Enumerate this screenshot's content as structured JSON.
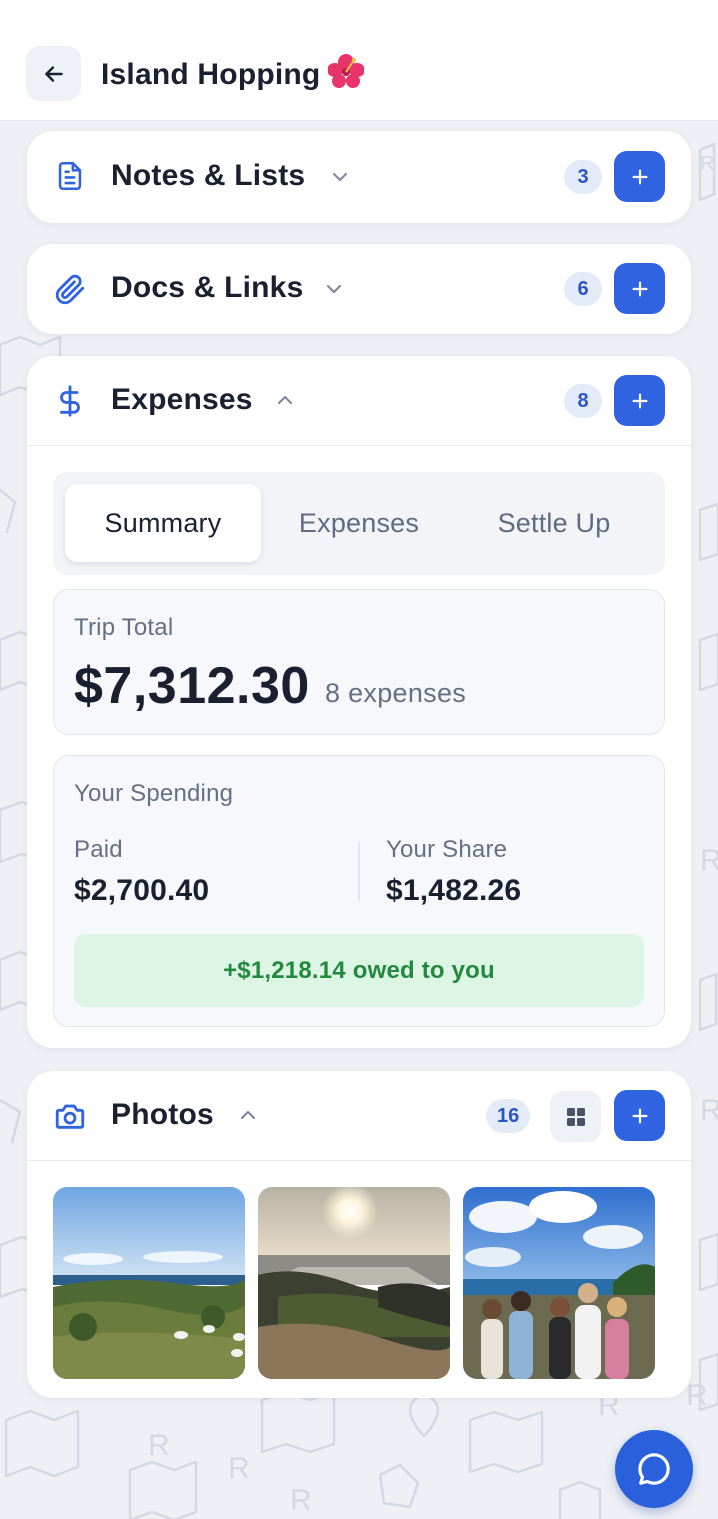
{
  "header": {
    "title": "Island Hopping",
    "emoji": "🌺"
  },
  "sections": {
    "notes": {
      "title": "Notes & Lists",
      "count": "3",
      "icon": "document-icon",
      "expanded": false
    },
    "docs": {
      "title": "Docs & Links",
      "count": "6",
      "icon": "paperclip-icon",
      "expanded": false
    },
    "expenses": {
      "title": "Expenses",
      "count": "8",
      "icon": "dollar-icon",
      "expanded": true,
      "tabs": [
        "Summary",
        "Expenses",
        "Settle Up"
      ],
      "active_tab": "Summary",
      "trip_total": {
        "label": "Trip Total",
        "amount": "$7,312.30",
        "count_text": "8 expenses"
      },
      "your_spending": {
        "label": "Your Spending",
        "paid_label": "Paid",
        "paid_value": "$2,700.40",
        "share_label": "Your Share",
        "share_value": "$1,482.26",
        "owed_text": "+$1,218.14 owed to you"
      }
    },
    "photos": {
      "title": "Photos",
      "count": "16",
      "icon": "camera-icon",
      "expanded": true,
      "items": [
        "photo-coast-birds",
        "photo-sunset-rocks",
        "photo-group-beach"
      ]
    }
  },
  "colors": {
    "accent": "#2f63e0",
    "badge_bg": "#e3ebf9",
    "badge_text": "#2c56c4",
    "owed_bg": "#dcf5e4",
    "owed_text": "#23893f",
    "page_bg": "#eef0f5"
  }
}
